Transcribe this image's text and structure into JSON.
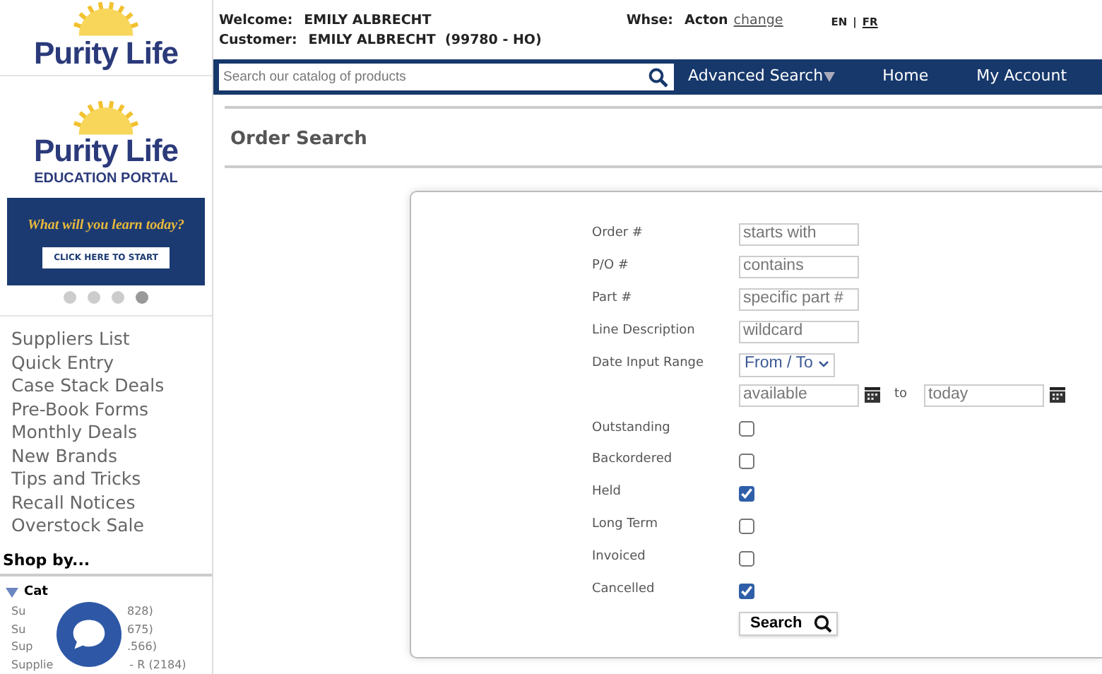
{
  "logo": {
    "text": "Purity Life"
  },
  "banner": {
    "brand": "Purity Life",
    "subtitle": "EDUCATION PORTAL",
    "tagline": "What will you learn today?",
    "cta": "CLICK HERE TO START"
  },
  "carousel_dots": [
    {
      "selected": false
    },
    {
      "selected": false
    },
    {
      "selected": false
    },
    {
      "selected": true
    }
  ],
  "sidebar": {
    "links": [
      "Suppliers List",
      "Quick Entry",
      "Case Stack Deals",
      "Pre-Book Forms",
      "Monthly Deals",
      "New Brands",
      "Tips and Tricks",
      "Recall Notices",
      "Overstock Sale"
    ],
    "shop_by": "Shop by...",
    "category_header": {
      "label": "Cat",
      "expanded": true
    },
    "categories": [
      {
        "start": "Su",
        "end": "828)"
      },
      {
        "start": "Su",
        "end": "675)"
      },
      {
        "start": "Sup",
        "end": ".566)"
      },
      {
        "start": "Supplie",
        "end": "- R (2184)"
      }
    ]
  },
  "header": {
    "welcome_label": "Welcome:",
    "welcome_name": "EMILY ALBRECHT",
    "customer_label": "Customer:",
    "customer_name": "EMILY ALBRECHT  (99780 - HO)",
    "whse_label": "Whse:",
    "whse_value": "Acton",
    "change_link": "change",
    "languages": [
      {
        "label": "EN",
        "selected": true
      },
      {
        "label": "FR",
        "selected": false
      }
    ],
    "lang_separator": "|"
  },
  "nav": {
    "search_placeholder": "Search our catalog of products",
    "items": [
      "Advanced Search",
      "Home",
      "My Account"
    ]
  },
  "page_title": "Order Search",
  "form": {
    "fields": [
      {
        "label": "Order #",
        "placeholder": "starts with"
      },
      {
        "label": "P/O #",
        "placeholder": "contains"
      },
      {
        "label": "Part #",
        "placeholder": "specific part #"
      },
      {
        "label": "Line Description",
        "placeholder": "wildcard"
      }
    ],
    "date_range": {
      "label": "Date Input Range",
      "select": "From / To",
      "from_placeholder": "available",
      "to_label": "to",
      "to_placeholder": "today"
    },
    "checkboxes": [
      {
        "label": "Outstanding",
        "checked": false
      },
      {
        "label": "Backordered",
        "checked": false
      },
      {
        "label": "Held",
        "checked": true
      },
      {
        "label": "Long Term",
        "checked": false
      },
      {
        "label": "Invoiced",
        "checked": false
      },
      {
        "label": "Cancelled",
        "checked": true
      }
    ],
    "search_button": "Search"
  }
}
